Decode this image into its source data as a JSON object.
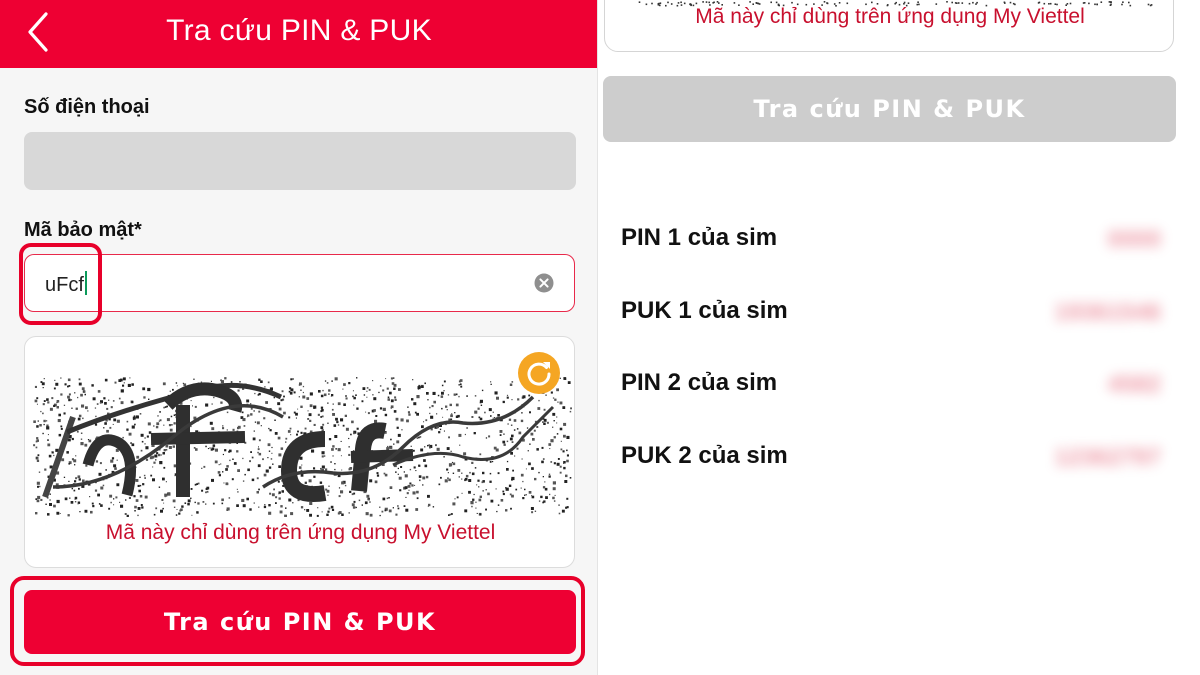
{
  "header": {
    "title": "Tra cứu PIN & PUK",
    "back_icon": "chevron-left-icon"
  },
  "form": {
    "phone_label": "Số điện thoại",
    "phone_value": "",
    "security_label": "Mã bảo mật*",
    "security_value": "uFcf",
    "captcha_text": "uFcf",
    "captcha_note": "Mã này chỉ dùng trên ứng dụng My Viettel",
    "submit_label": "Tra cứu PIN & PUK"
  },
  "result_panel": {
    "captcha_note": "Mã này chỉ dùng trên ứng dụng My Viettel",
    "submit_label": "Tra cứu PIN & PUK",
    "rows": [
      {
        "label": "PIN 1 của sim",
        "value": "0000"
      },
      {
        "label": "PUK 1 của sim",
        "value": "19361546"
      },
      {
        "label": "PIN 2 của sim",
        "value": "4582"
      },
      {
        "label": "PUK 2 của sim",
        "value": "12362797"
      }
    ]
  },
  "colors": {
    "brand_red": "#ee0033",
    "note_red": "#c8102e",
    "highlight_red": "#e8002a",
    "refresh_orange": "#f5a623",
    "disabled_gray": "#cdcdcd"
  }
}
